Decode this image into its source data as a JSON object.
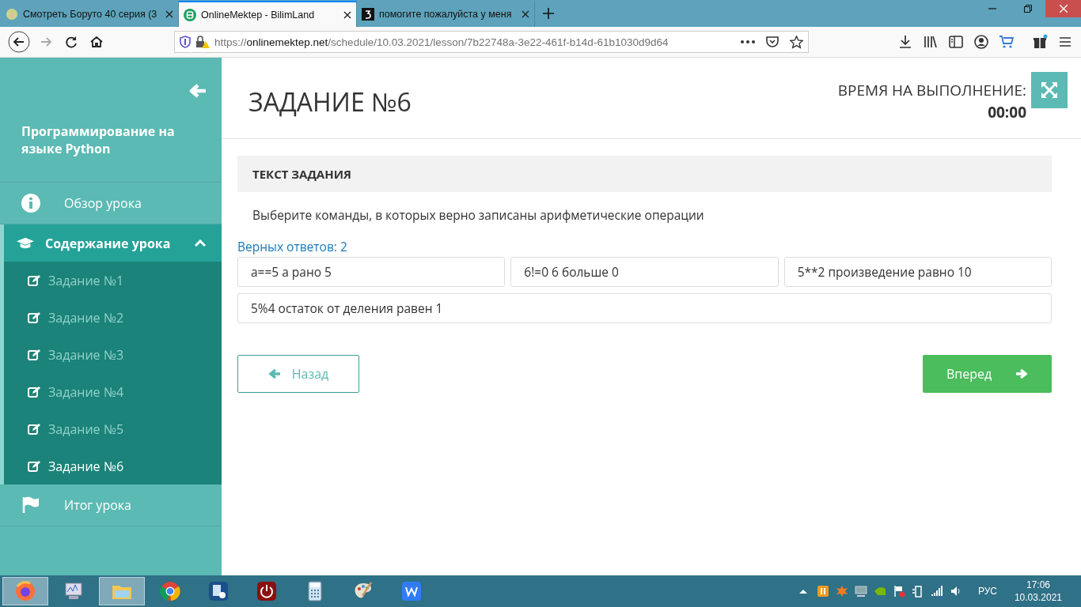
{
  "browser": {
    "tabs": [
      {
        "title": "Смотреть Боруто 40 серия (3",
        "selected": false
      },
      {
        "title": "OnlineMektep - BilimLand",
        "selected": true
      },
      {
        "title": "помогите пожалуйста у меня",
        "selected": false
      }
    ],
    "url": {
      "scheme": "https://",
      "host": "onlinemektep.net",
      "path": "/schedule/10.03.2021/lesson/7b22748a-3e22-461f-b14d-61b1030d9d64"
    }
  },
  "sidebar": {
    "course_title": "Программирование на языке Python",
    "items": [
      {
        "kind": "link",
        "label": "Обзор урока"
      },
      {
        "kind": "group",
        "label": "Содержание урока",
        "expanded": true,
        "children": [
          {
            "label": "Задание №1",
            "selected": false
          },
          {
            "label": "Задание №2",
            "selected": false
          },
          {
            "label": "Задание №3",
            "selected": false
          },
          {
            "label": "Задание №4",
            "selected": false
          },
          {
            "label": "Задание №5",
            "selected": false
          },
          {
            "label": "Задание №6",
            "selected": true
          }
        ]
      },
      {
        "kind": "link",
        "label": "Итог урока"
      }
    ]
  },
  "task": {
    "title": "ЗАДАНИЕ №6",
    "time_label": "ВРЕМЯ НА ВЫПОЛНЕНИЕ:",
    "time": "00:00",
    "section_title": "ТЕКСТ ЗАДАНИЯ",
    "question": "Выберите команды, в которых верно записаны арифметические операции",
    "correct_count": "Верных ответов: 2",
    "options": [
      {
        "text": "a==5 a рано 5",
        "selected": false
      },
      {
        "text": "6!=0 6 больше 0",
        "selected": false
      },
      {
        "text": "5**2 произведение равно 10",
        "selected": false
      },
      {
        "text": "5%4 остаток от деления равен 1",
        "selected": false
      }
    ],
    "back_button": "Назад",
    "next_button": "Вперед"
  },
  "taskbar": {
    "language": "РУС",
    "time": "17:06",
    "date": "10.03.2021"
  }
}
